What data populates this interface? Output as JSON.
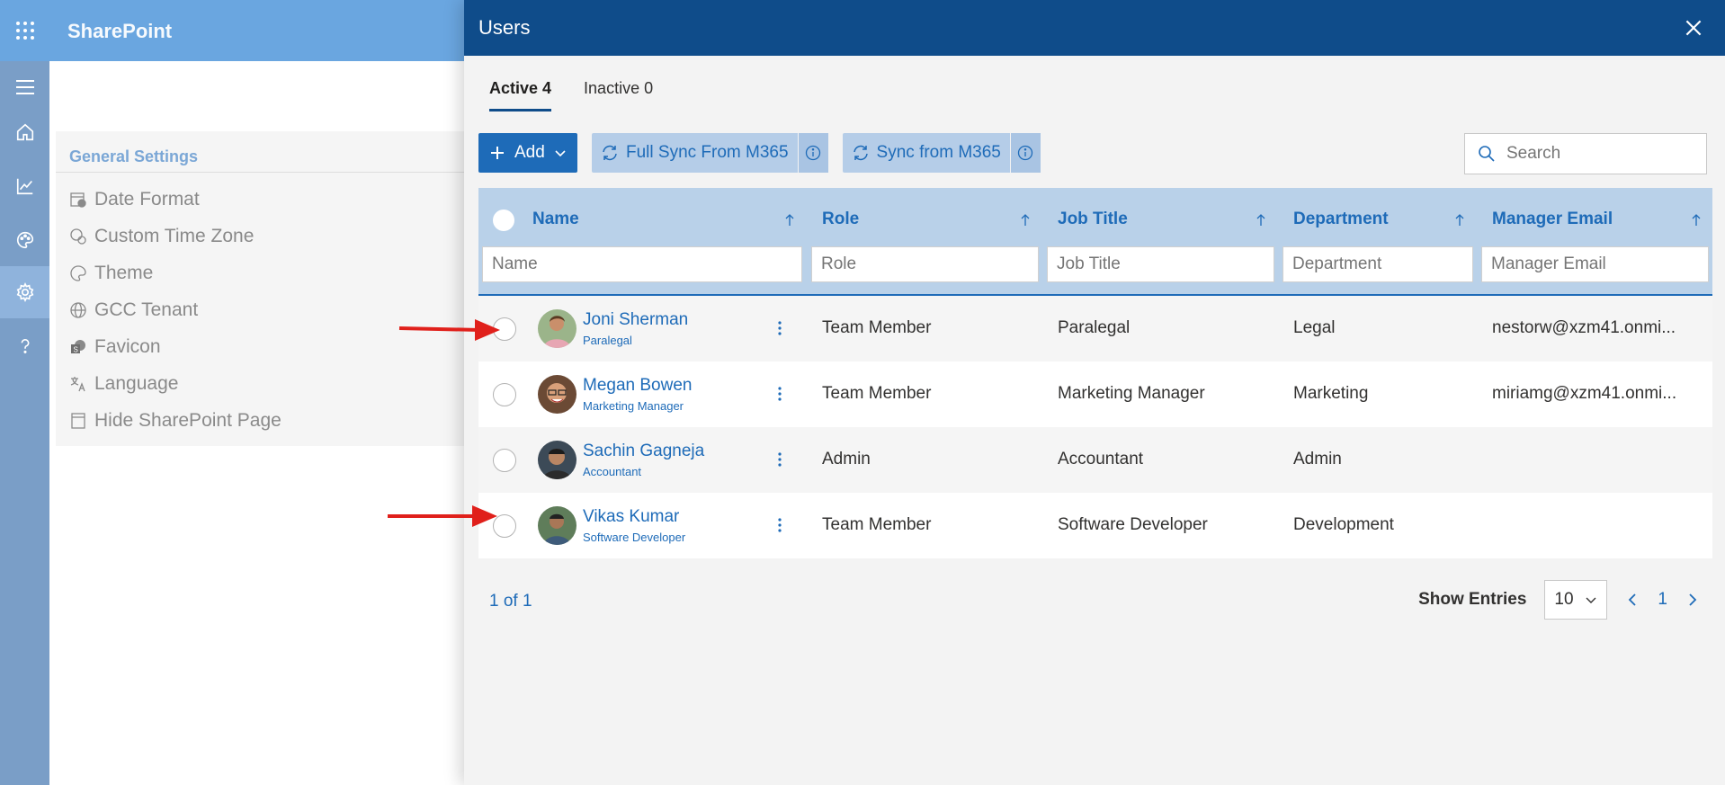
{
  "app": {
    "title": "SharePoint"
  },
  "settings": {
    "title": "General Settings",
    "items": [
      {
        "label": "Date Format",
        "icon": "calendar-clock-icon"
      },
      {
        "label": "Custom Time Zone",
        "icon": "globe-clock-icon"
      },
      {
        "label": "Theme",
        "icon": "palette-icon"
      },
      {
        "label": "GCC Tenant",
        "icon": "globe-icon"
      },
      {
        "label": "Favicon",
        "icon": "sharepoint-logo-icon"
      },
      {
        "label": "Language",
        "icon": "translate-icon"
      },
      {
        "label": "Hide SharePoint Page",
        "icon": "page-icon"
      }
    ]
  },
  "panel": {
    "title": "Users",
    "tabs": [
      {
        "label": "Active 4",
        "active": true
      },
      {
        "label": "Inactive 0",
        "active": false
      }
    ],
    "toolbar": {
      "add_label": "Add",
      "full_sync_label": "Full Sync From M365",
      "sync_label": "Sync from M365"
    },
    "search": {
      "placeholder": "Search"
    },
    "columns": [
      {
        "label": "Name",
        "filter_placeholder": "Name"
      },
      {
        "label": "Role",
        "filter_placeholder": "Role"
      },
      {
        "label": "Job Title",
        "filter_placeholder": "Job Title"
      },
      {
        "label": "Department",
        "filter_placeholder": "Department"
      },
      {
        "label": "Manager Email",
        "filter_placeholder": "Manager Email"
      }
    ],
    "rows": [
      {
        "name": "Joni Sherman",
        "sub": "Paralegal",
        "role": "Team Member",
        "job_title": "Paralegal",
        "department": "Legal",
        "manager_email": "nestorw@xzm41.onmi..."
      },
      {
        "name": "Megan Bowen",
        "sub": "Marketing Manager",
        "role": "Team Member",
        "job_title": "Marketing Manager",
        "department": "Marketing",
        "manager_email": "miriamg@xzm41.onmi..."
      },
      {
        "name": "Sachin Gagneja",
        "sub": "Accountant",
        "role": "Admin",
        "job_title": "Accountant",
        "department": "Admin",
        "manager_email": ""
      },
      {
        "name": "Vikas Kumar",
        "sub": "Software Developer",
        "role": "Team Member",
        "job_title": "Software Developer",
        "department": "Development",
        "manager_email": ""
      }
    ],
    "pager": {
      "summary": "1 of 1",
      "show_entries_label": "Show Entries",
      "page_size": "10",
      "current_page": "1"
    }
  },
  "colors": {
    "header_bg": "#0f4c8a",
    "accent": "#1e6bb8",
    "grid_header_bg": "#b9d1e9",
    "rail_bg": "#7a9ec7",
    "annotation_arrow": "#e0201b"
  }
}
